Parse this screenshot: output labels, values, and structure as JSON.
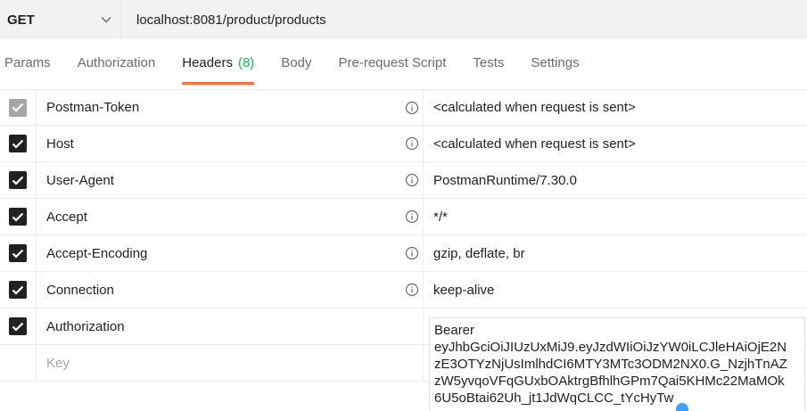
{
  "request": {
    "method": "GET",
    "url": "localhost:8081/product/products"
  },
  "icons": {
    "method_dropdown": "chevron-down-icon",
    "info": "info-circle-icon",
    "check": "checkmark-icon"
  },
  "colors": {
    "accent": "#ff6c37",
    "count_green": "#0cbb52",
    "checkbox": "#212121",
    "checkbox_disabled": "#a6a6a6"
  },
  "tabs": [
    {
      "label": "Params"
    },
    {
      "label": "Authorization"
    },
    {
      "label": "Headers",
      "count": "(8)",
      "active": true
    },
    {
      "label": "Body"
    },
    {
      "label": "Pre-request Script"
    },
    {
      "label": "Tests"
    },
    {
      "label": "Settings"
    }
  ],
  "headers": [
    {
      "key": "Postman-Token",
      "value": "<calculated when request is sent>",
      "checked": true,
      "disabled": true
    },
    {
      "key": "Host",
      "value": "<calculated when request is sent>",
      "checked": true
    },
    {
      "key": "User-Agent",
      "value": "PostmanRuntime/7.30.0",
      "checked": true
    },
    {
      "key": "Accept",
      "value": "*/*",
      "checked": true
    },
    {
      "key": "Accept-Encoding",
      "value": "gzip, deflate, br",
      "checked": true
    },
    {
      "key": "Connection",
      "value": "keep-alive",
      "checked": true
    },
    {
      "key": "Authorization",
      "value": "Bearer eyJhbGciOiJIUzUxMiJ9.eyJzdWIiOiJzYW0iLCJleHAiOjE2NzE3OTYzNjUsImlhdCI6MTY3MTc3ODM2NX0.G_NzjhTnAZzW5yvqoVFqGUxbOAktrgBfhlhGPm7Qai5KHMc22MaMOk6U5oBtai62Uh_jt1JdWqCLCC_tYcHyTw",
      "checked": true
    }
  ],
  "new_row": {
    "key_placeholder": "Key"
  },
  "auth_editor": {
    "line1": "Bearer",
    "line2": "eyJhbGciOiJIUzUxMiJ9.eyJzdWIiOiJzYW0iLCJleHAiOjE2N",
    "line3": "zE3OTYzNjUsImlhdCI6MTY3MTc3ODM2NX0.G_NzjhTnAZ",
    "line4": "zW5yvqoVFqGUxbOAktrgBfhlhGPm7Qai5KHMc22MaMOk",
    "line5": "6U5oBtai62Uh_jt1JdWqCLCC_tYcHyTw"
  }
}
